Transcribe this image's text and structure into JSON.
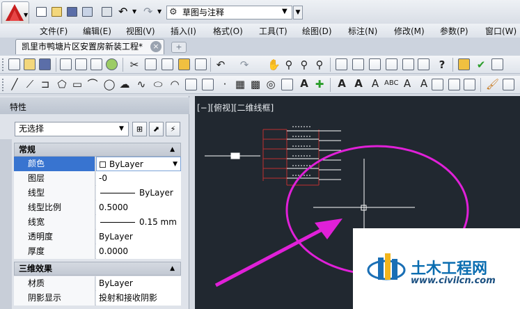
{
  "workspace": {
    "selected": "草图与注释"
  },
  "menu": {
    "items": [
      "文件(F)",
      "编辑(E)",
      "视图(V)",
      "插入(I)",
      "格式(O)",
      "工具(T)",
      "绘图(D)",
      "标注(N)",
      "修改(M)",
      "参数(P)",
      "窗口(W)"
    ]
  },
  "document": {
    "tab_title": "凯里市鸭塘片区安置房新装工程*"
  },
  "properties": {
    "panel_title": "特性",
    "selection": "无选择",
    "general": {
      "title": "常规",
      "rows": [
        {
          "label": "颜色",
          "value": "ByLayer"
        },
        {
          "label": "图层",
          "value": "-0"
        },
        {
          "label": "线型",
          "value": "ByLayer"
        },
        {
          "label": "线型比例",
          "value": "0.5000"
        },
        {
          "label": "线宽",
          "value": "0.15 mm"
        },
        {
          "label": "透明度",
          "value": "ByLayer"
        },
        {
          "label": "厚度",
          "value": "0.0000"
        }
      ]
    },
    "three_d": {
      "title": "三维效果",
      "rows": [
        {
          "label": "材质",
          "value": "ByLayer"
        },
        {
          "label": "阴影显示",
          "value": "投射和接收阴影"
        }
      ]
    }
  },
  "viewport": {
    "label": "[−][俯视][二维线框]"
  },
  "watermark": {
    "name": "土木工程网",
    "url": "www.civilcn.com"
  },
  "colors": {
    "canvas": "#212830",
    "highlight": "#e020d8",
    "selected_row": "#3874d0"
  }
}
